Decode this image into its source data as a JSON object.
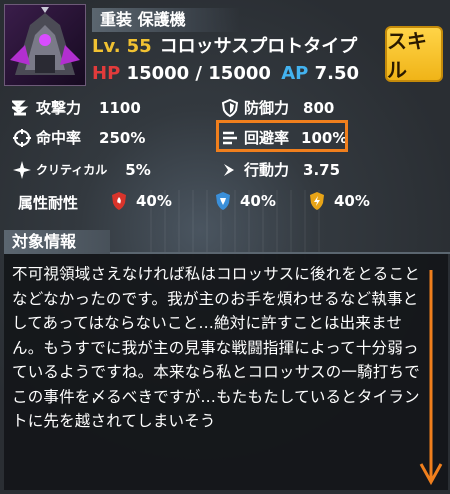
{
  "header": {
    "category": "重装 保護機",
    "level_label": "Lv.",
    "level_value": "55",
    "unit_name": "コロッサスプロトタイプ",
    "hp_label": "HP",
    "hp_value": "15000 / 15000",
    "ap_label": "AP",
    "ap_value": "7.50",
    "skill_button": "スキル"
  },
  "stats": {
    "attack": {
      "label": "攻撃力",
      "value": "1100",
      "icon": "sword-icon"
    },
    "defense": {
      "label": "防御力",
      "value": "800",
      "icon": "shield-icon"
    },
    "accuracy": {
      "label": "命中率",
      "value": "250%",
      "icon": "crosshair-icon"
    },
    "evasion": {
      "label": "回避率",
      "value": "100%",
      "icon": "wind-icon"
    },
    "critical": {
      "label": "クリティカル",
      "value": "5%",
      "icon": "sparkle-icon"
    },
    "speed": {
      "label": "行動力",
      "value": "3.75",
      "icon": "chevron-icon"
    }
  },
  "resistances": {
    "label": "属性耐性",
    "fire": {
      "value": "40%",
      "icon": "fire-shield-icon",
      "color": "#d9342b"
    },
    "ice": {
      "value": "40%",
      "icon": "ice-shield-icon",
      "color": "#3a8fd9"
    },
    "electric": {
      "value": "40%",
      "icon": "electric-shield-icon",
      "color": "#e8a417"
    }
  },
  "target_info": {
    "title": "対象情報",
    "text": "不可視領域さえなければ私はコロッサスに後れをとることなどなかったのです。我が主のお手を煩わせるなど執事としてあってはならないこと…絶対に許すことは出来ません。もうすでに我が主の見事な戦闘指揮によって十分弱っているようですね。本来なら私とコロッサスの一騎打ちでこの事件を〆るべきですが…もたもたしているとタイラントに先を越されてしまいそう"
  },
  "colors": {
    "highlight": "#f07f1d",
    "level": "#f1c232",
    "hp": "#e23b3b",
    "ap": "#43b3f0",
    "skill": "#ffd447"
  }
}
